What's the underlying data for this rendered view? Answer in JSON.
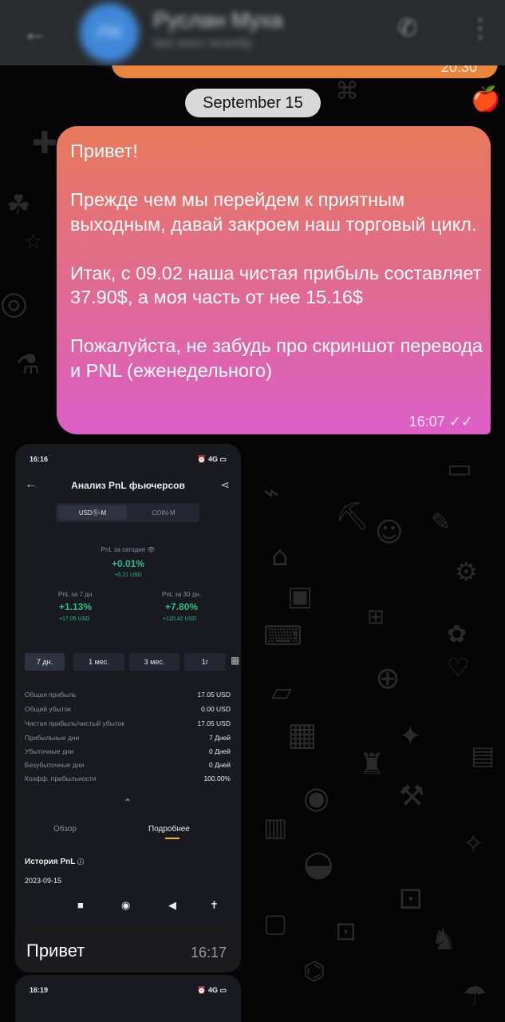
{
  "header": {
    "contact_name": "Руслан Муха",
    "status": "last seen recently",
    "avatar_initials": "РМ"
  },
  "prev_message": {
    "time": "20:30"
  },
  "date_chip": "September 15",
  "message": {
    "text": "Привет!\n\nПрежде чем мы перейдем к приятным выходным, давай закроем наш торговый цикл.\n\nИтак, с 09.02 наша чистая прибыль составляет 37.90$, а моя часть от нее 15.16$\n\nПожалуйста, не забудь про скриншот перевода и PNL (еженедельного)",
    "time": "16:07",
    "ticks": "✓✓"
  },
  "photo_message": {
    "caption": "Привет",
    "time": "16:17",
    "screenshot": {
      "status_time": "16:16",
      "status_icons": "⏰ 4G ▭",
      "title": "Анализ PnL фьючерсов",
      "seg_active": "USDⓈ-M",
      "seg_inactive": "COIN-M",
      "today_label": "PnL за сегодня",
      "today_pct": "+0.01%",
      "today_usd": "+0.21 USD",
      "d7_label": "PnL за 7 дн.",
      "d7_pct": "+1.13%",
      "d7_usd": "+17.05 USD",
      "d30_label": "PnL за 30 дн.",
      "d30_pct": "+7.80%",
      "d30_usd": "+120.42 USD",
      "tabs": [
        "7 дн.",
        "1 мес.",
        "3 мес.",
        "1г"
      ],
      "stats": [
        {
          "k": "Общая прибыль",
          "v": "17.05 USD"
        },
        {
          "k": "Общий убыток",
          "v": "0.00 USD"
        },
        {
          "k": "Чистая прибыль/чистый убыток",
          "v": "17.05 USD"
        },
        {
          "k": "Прибыльные дни",
          "v": "7 Дней"
        },
        {
          "k": "Убыточные дни",
          "v": "0 Дней"
        },
        {
          "k": "Безубыточные дни",
          "v": "0 Дней"
        },
        {
          "k": "Коэфф. прибыльности",
          "v": "100.00%"
        }
      ],
      "subtab_overview": "Обзор",
      "subtab_details": "Подробнее",
      "history_label": "История PnL",
      "history_date": "2023-09-15"
    }
  },
  "photo2": {
    "status_time": "16:19",
    "status_icons": "⏰ 4G ▭"
  }
}
